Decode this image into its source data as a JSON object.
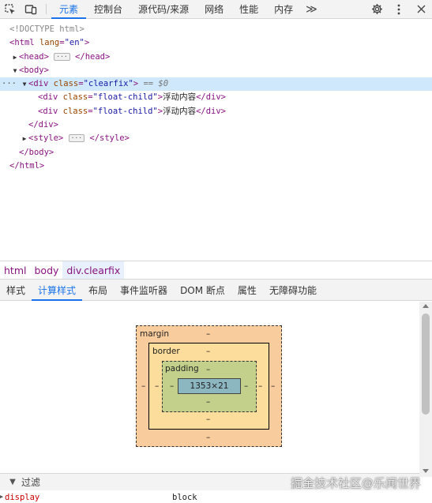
{
  "topbar": {
    "tabs": [
      "元素",
      "控制台",
      "源代码/来源",
      "网络",
      "性能",
      "内存"
    ],
    "more": "≫"
  },
  "dom": {
    "doctype": "<!DOCTYPE html>",
    "html_open": {
      "tag": "html",
      "attr": "lang",
      "value": "\"en\""
    },
    "head": {
      "open": "<head>",
      "ellipsis": "···",
      "close": "</head>"
    },
    "body_open": "<body>",
    "div": {
      "tag": "div",
      "attr": "class",
      "value": "\"clearfix\"",
      "suffix": "== $0"
    },
    "children": [
      {
        "tag": "div",
        "attr": "class",
        "value": "\"float-child\"",
        "text": "浮动内容",
        "close": "</div>"
      },
      {
        "tag": "div",
        "attr": "class",
        "value": "\"float-child\"",
        "text": "浮动内容",
        "close": "</div>"
      }
    ],
    "div_close": "</div>",
    "style": {
      "open": "<style>",
      "ellipsis": "···",
      "close": "</style>"
    },
    "body_close": "</body>",
    "html_close": "</html>",
    "selected_dots": "···"
  },
  "breadcrumb": [
    "html",
    "body",
    "div.clearfix"
  ],
  "subtabs": [
    "样式",
    "计算样式",
    "布局",
    "事件监听器",
    "DOM 断点",
    "属性",
    "无障碍功能"
  ],
  "box_model": {
    "margin_label": "margin",
    "border_label": "border",
    "padding_label": "padding",
    "content": "1353×21",
    "dash": "–"
  },
  "filter": {
    "label": "过滤"
  },
  "property": {
    "name": "display",
    "value": "block"
  },
  "watermark": "掘金技术社区@乐闻世界"
}
